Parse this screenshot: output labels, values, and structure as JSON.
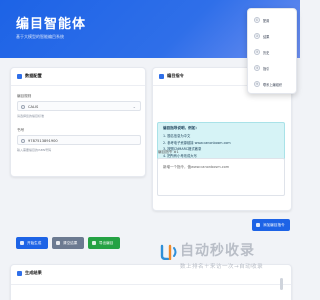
{
  "header": {
    "title": "编目智能体",
    "subtitle": "基于大模型的智能编目系统"
  },
  "config_card": {
    "title": "数据配置",
    "catalog_rule_label": "编目规则",
    "catalog_rule_value": "CALIS",
    "catalog_rule_hint": "请选择您的编目标准",
    "isbn_label": "书号",
    "isbn_value": "9787513891900",
    "isbn_hint": "输入需要编目的ISBN号码"
  },
  "instruction_card": {
    "title": "编目指令",
    "tips_title": "编目指导说明，例如：",
    "tips": [
      "1. 题名信息为中文",
      "2. 参考电子资源链接 www.canonbosm.com",
      "3. 按照CNMARC格式著录",
      "4. 把所有小号改成大写"
    ],
    "textarea_label": "编目指令 #1",
    "textarea_placeholder": "新增一个指令，值www.canonbosm.com",
    "add_button": "添加编目指令"
  },
  "actions": {
    "generate": "开始生成",
    "clear": "清空结果",
    "export": "导出编目"
  },
  "result_card": {
    "title": "生成结果"
  },
  "menu": {
    "items": [
      {
        "icon": "①",
        "label": "配置"
      },
      {
        "icon": "②",
        "label": "结果"
      },
      {
        "icon": "③",
        "label": "历史"
      },
      {
        "icon": "④",
        "label": "指引"
      },
      {
        "icon": "⑤",
        "label": "联系上编组织"
      }
    ]
  },
  "watermark": {
    "text": "自动秒收录",
    "subtitle": "数上排名＋来访一次→自动收录"
  },
  "colors": {
    "primary": "#1d63e6",
    "info_bg": "#d6f3f6",
    "clear_button": "#6c7a91",
    "export_button": "#25a244"
  }
}
